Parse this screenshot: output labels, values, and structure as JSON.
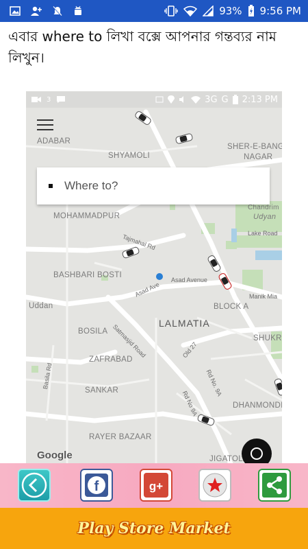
{
  "status_bar": {
    "battery": "93%",
    "time": "9:56 PM"
  },
  "instruction": "এবার where to লিখা বক্সে আপনার গন্তব্যর নাম লিখুন।",
  "phone": {
    "status": {
      "badge": "3",
      "network": "3G",
      "network2": "G",
      "time": "2:13 PM"
    },
    "search_placeholder": "Where to?",
    "map_labels": {
      "adabar": "ADABAR",
      "shyamoli": "SHYAMOLI",
      "sher_e_bangla_1": "SHER-E-BANGL",
      "sher_e_bangla_2": "NAGAR",
      "mohammadpur": "MOHAMMADPUR",
      "chandrima_1": "Chandrim",
      "chandrima_2": "Udyan",
      "lake_road": "Lake Road",
      "tajmahal_rd": "Tajmahal Rd",
      "bashbari_bosti": "BASHBARI BOSTI",
      "asad_avenue": "Asad Avenue",
      "asad_ave": "Asad Ave",
      "manik_mia": "Manik Mia",
      "uddan": "Uddan",
      "block_a": "BLOCK A",
      "lalmatia": "LALMATIA",
      "satmasjid_road": "Satmasjid Road",
      "bosila": "BOSILA",
      "shukr": "SHUKR",
      "old_27": "Old 27",
      "zafrabad": "ZAFRABAD",
      "rd_no_9a_1": "Rd No. 9A",
      "basila_rd": "Basila Rd",
      "sankar": "SANKAR",
      "rd_no_9a_2": "Rd No 9A",
      "dhanmondi": "DHANMONDI",
      "rayer_bazaar": "RAYER BAZAAR",
      "jigatola": "JIGATOLA",
      "google": "Google"
    }
  },
  "share_buttons": [
    "back",
    "facebook",
    "google-plus",
    "favorite",
    "share"
  ],
  "footer": {
    "title": "Play Store Market"
  },
  "colors": {
    "status_bar": "#1f57c3",
    "share_bar": "#f7a9c0",
    "footer": "#f7a50d",
    "footer_text": "#fff59a"
  }
}
